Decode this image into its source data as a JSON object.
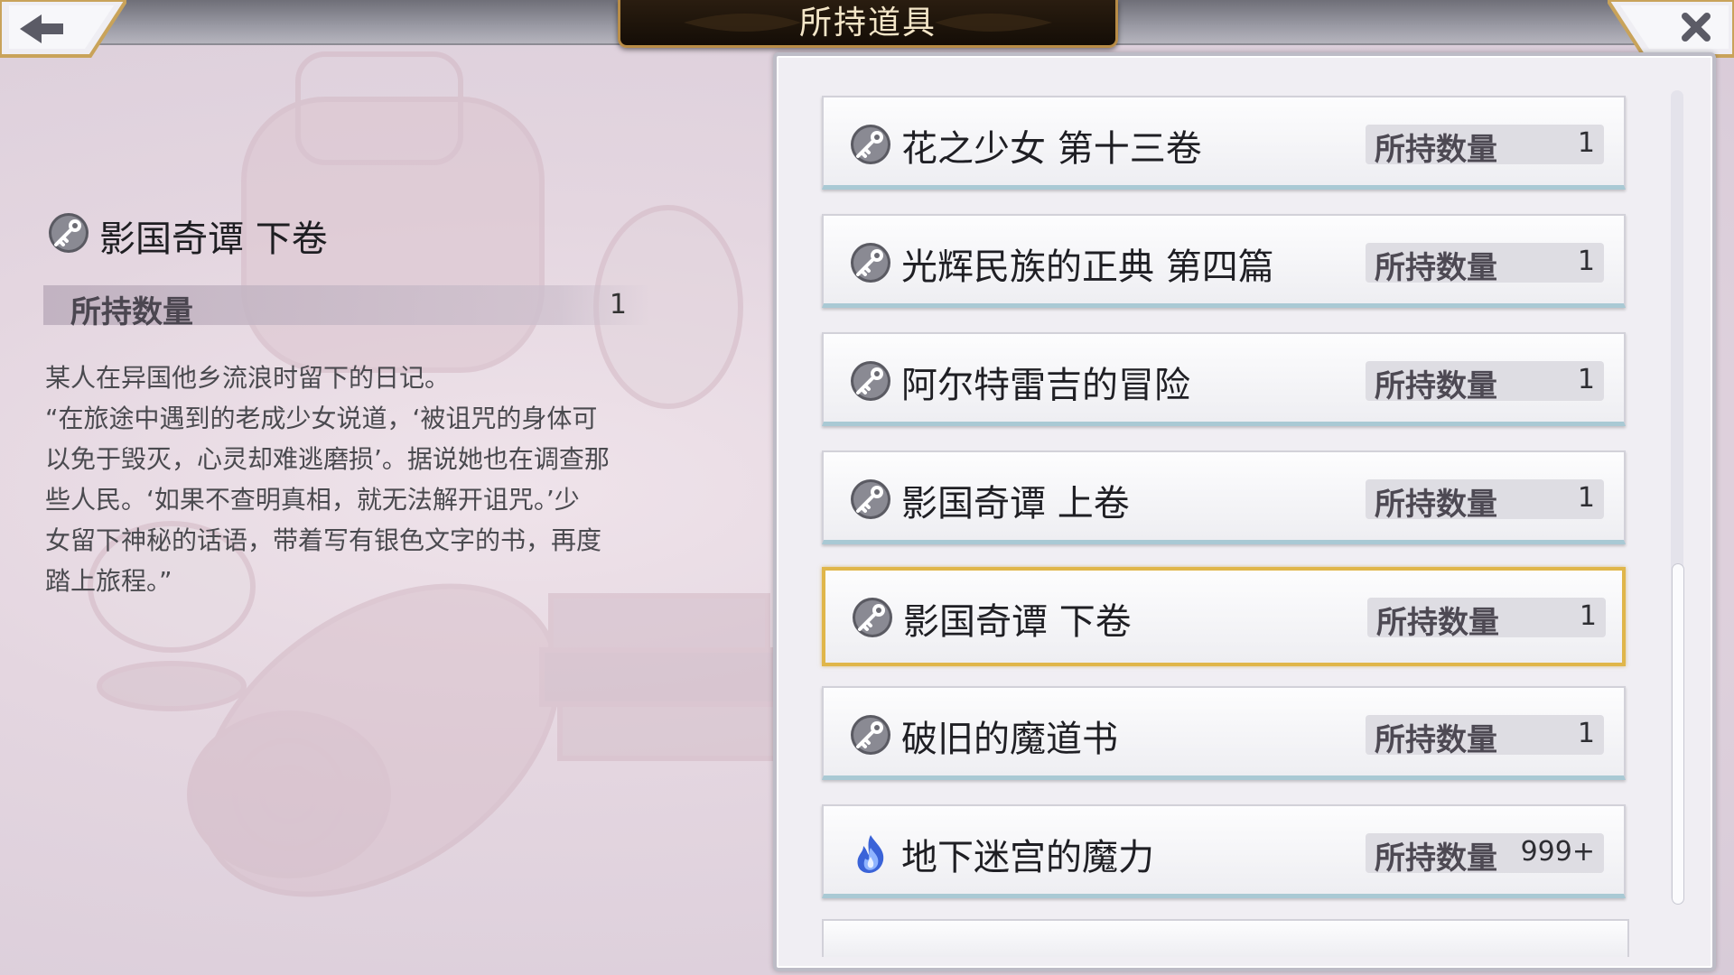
{
  "header": {
    "title": "所持道具"
  },
  "nav": {
    "back_icon": "arrow-left-icon",
    "close_icon": "close-icon"
  },
  "detail": {
    "icon": "key-icon",
    "name": "影国奇谭 下卷",
    "qty_label": "所持数量",
    "qty_value": "1",
    "description": [
      "某人在异国他乡流浪时留下的日记。",
      "“在旅途中遇到的老成少女说道，‘被诅咒的身体可",
      "以免于毁灭，心灵却难逃磨损’。据说她也在调查那",
      "些人民。‘如果不查明真相，就无法解开诅咒。’少",
      "女留下神秘的话语，带着写有银色文字的书，再度",
      "踏上旅程。”"
    ]
  },
  "items": [
    {
      "name": "花之少女 第十三卷",
      "qty_label": "所持数量",
      "qty": "1",
      "icon": "key-icon",
      "selected": false
    },
    {
      "name": "光辉民族的正典 第四篇",
      "qty_label": "所持数量",
      "qty": "1",
      "icon": "key-icon",
      "selected": false
    },
    {
      "name": "阿尔特雷吉的冒险",
      "qty_label": "所持数量",
      "qty": "1",
      "icon": "key-icon",
      "selected": false
    },
    {
      "name": "影国奇谭 上卷",
      "qty_label": "所持数量",
      "qty": "1",
      "icon": "key-icon",
      "selected": false
    },
    {
      "name": "影国奇谭 下卷",
      "qty_label": "所持数量",
      "qty": "1",
      "icon": "key-icon",
      "selected": true
    },
    {
      "name": "破旧的魔道书",
      "qty_label": "所持数量",
      "qty": "1",
      "icon": "key-icon",
      "selected": false
    },
    {
      "name": "地下迷宫的魔力",
      "qty_label": "所持数量",
      "qty": "999+",
      "icon": "blue-flame-icon",
      "selected": false
    }
  ],
  "colors": {
    "selected_border": "#e0b64a",
    "title_bg": "#1a1208",
    "title_text": "#f4e6c8"
  }
}
